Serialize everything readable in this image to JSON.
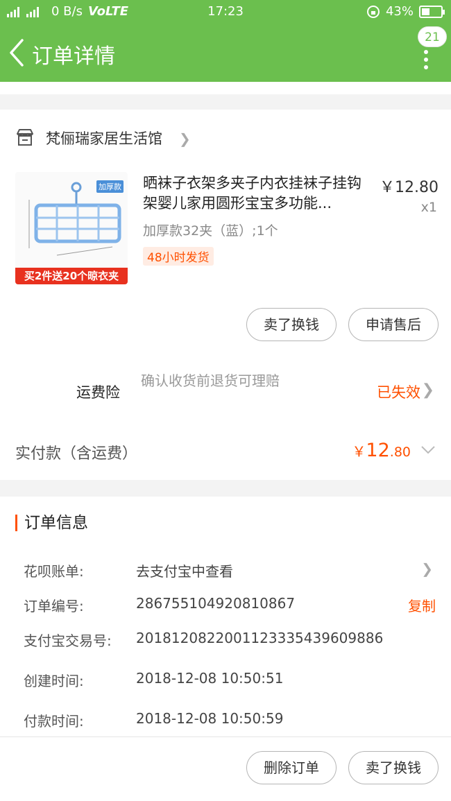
{
  "status_bar": {
    "network_left": "4G 2G",
    "speed": "0 B/s",
    "volte": "VoLTE",
    "time": "17:23",
    "battery_percent": "43%",
    "battery_level": 0.43
  },
  "header": {
    "title": "订单详情",
    "badge_count": "21"
  },
  "shop": {
    "name": "梵俪瑞家居生活馆"
  },
  "product": {
    "title": "晒袜子衣架多夹子内衣挂袜子挂钩架婴儿家用圆形宝宝多功能...",
    "price": "￥12.80",
    "qty": "x1",
    "spec": "加厚款32夹（蓝）;1个",
    "shipping_tag": "48小时发货",
    "thumb_banner": "买2件送20个晾衣夹",
    "thumb_tag": "加厚款"
  },
  "actions": {
    "sell_label": "卖了换钱",
    "after_sale_label": "申请售后"
  },
  "insurance": {
    "label": "运费险",
    "desc": "确认收货前退货可理赔",
    "status": "已失效"
  },
  "payment": {
    "label": "实付款（含运费）",
    "currency": "￥",
    "amount_int": "12",
    "amount_dec": ".80"
  },
  "order_info": {
    "title": "订单信息",
    "rows": [
      {
        "key": "花呗账单:",
        "value": "去支付宝中查看"
      },
      {
        "key": "订单编号:",
        "value": "286755104920810867",
        "action": "复制"
      },
      {
        "key": "支付宝交易号:",
        "value": "2018120822001123335439609886"
      },
      {
        "key": "创建时间:",
        "value": "2018-12-08 10:50:51"
      },
      {
        "key": "付款时间:",
        "value": "2018-12-08 10:50:59"
      }
    ]
  },
  "bottom": {
    "delete_label": "删除订单",
    "sell_label": "卖了换钱"
  },
  "colors": {
    "header_green": "#6bbf4e",
    "accent_orange": "#ff5000"
  }
}
